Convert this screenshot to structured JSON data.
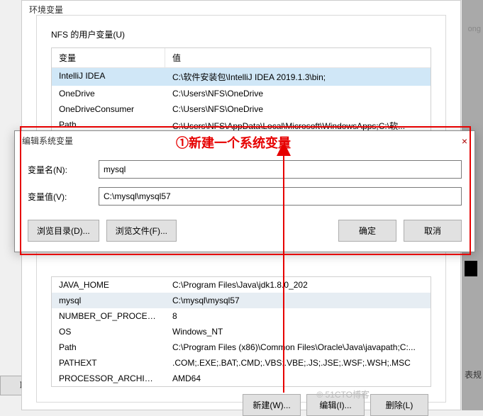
{
  "side_text_stats": "表规",
  "side_text_top": "ong",
  "cancel_bg_label": "取消",
  "main_title": "环境变量",
  "user_vars_label": "NFS 的用户变量(U)",
  "headers": {
    "var": "变量",
    "val": "值"
  },
  "user_vars": [
    {
      "k": "IntelliJ IDEA",
      "v": "C:\\软件安装包\\IntelliJ IDEA 2019.1.3\\bin;"
    },
    {
      "k": "OneDrive",
      "v": "C:\\Users\\NFS\\OneDrive"
    },
    {
      "k": "OneDriveConsumer",
      "v": "C:\\Users\\NFS\\OneDrive"
    },
    {
      "k": "Path",
      "v": "C:\\Users\\NFS\\AppData\\Local\\Microsoft\\WindowsApps;C:\\软..."
    }
  ],
  "sys_vars": [
    {
      "k": "JAVA_HOME",
      "v": "C:\\Program Files\\Java\\jdk1.8.0_202"
    },
    {
      "k": "mysql",
      "v": "C:\\mysql\\mysql57"
    },
    {
      "k": "NUMBER_OF_PROCESSORS",
      "v": "8"
    },
    {
      "k": "OS",
      "v": "Windows_NT"
    },
    {
      "k": "Path",
      "v": "C:\\Program Files (x86)\\Common Files\\Oracle\\Java\\javapath;C:..."
    },
    {
      "k": "PATHEXT",
      "v": ".COM;.EXE;.BAT;.CMD;.VBS;.VBE;.JS;.JSE;.WSF;.WSH;.MSC"
    },
    {
      "k": "PROCESSOR_ARCHITECT...",
      "v": "AMD64"
    }
  ],
  "btns": {
    "new": "新建(W)...",
    "edit": "编辑(I)...",
    "del": "删除(L)"
  },
  "edit_dialog": {
    "title": "编辑系统变量",
    "name_label": "变量名(N):",
    "name_value": "mysql",
    "value_label": "变量值(V):",
    "value_value": "C:\\mysql\\mysql57",
    "browse_dir": "浏览目录(D)...",
    "browse_file": "浏览文件(F)...",
    "ok": "确定",
    "cancel": "取消"
  },
  "annotation": "①新建一个系统变量",
  "watermark": "© 51CTO博客"
}
